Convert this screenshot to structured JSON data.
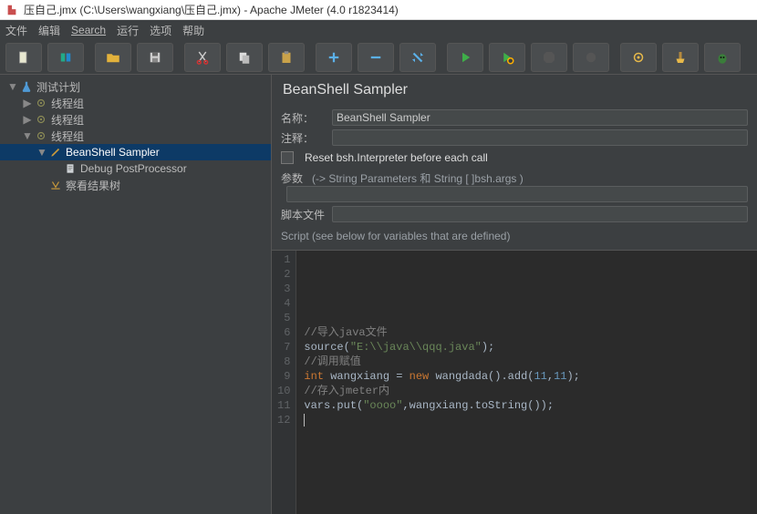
{
  "window": {
    "title": "压自己.jmx (C:\\Users\\wangxiang\\压自己.jmx) - Apache JMeter (4.0 r1823414)"
  },
  "menus": {
    "file": "文件",
    "edit": "编辑",
    "search": "Search",
    "run": "运行",
    "options": "选项",
    "help": "帮助"
  },
  "toolbar_icons": [
    "new-file-icon",
    "templates-icon",
    "open-icon",
    "save-icon",
    "cut-icon",
    "copy-icon",
    "paste-icon",
    "expand-icon",
    "collapse-icon",
    "toggle-icon",
    "start-icon",
    "start-no-timers-icon",
    "stop-icon",
    "shutdown-icon",
    "gear-icon",
    "broom-icon",
    "function-icon"
  ],
  "tree": [
    {
      "indent": 8,
      "toggle": "▼",
      "icon": "flask",
      "label": "测试计划",
      "selected": false,
      "name": "tree-testplan"
    },
    {
      "indent": 24,
      "toggle": "▶",
      "icon": "thread",
      "label": "线程组",
      "selected": false,
      "name": "tree-threadgroup-1"
    },
    {
      "indent": 24,
      "toggle": "▶",
      "icon": "thread",
      "label": "线程组",
      "selected": false,
      "name": "tree-threadgroup-2"
    },
    {
      "indent": 24,
      "toggle": "▼",
      "icon": "thread",
      "label": "线程组",
      "selected": false,
      "name": "tree-threadgroup-3"
    },
    {
      "indent": 40,
      "toggle": "▼",
      "icon": "pen",
      "label": "BeanShell Sampler",
      "selected": true,
      "name": "tree-beanshell-sampler"
    },
    {
      "indent": 56,
      "toggle": "",
      "icon": "doc",
      "label": "Debug PostProcessor",
      "selected": false,
      "name": "tree-debug-postprocessor"
    },
    {
      "indent": 40,
      "toggle": "",
      "icon": "eye",
      "label": "察看结果树",
      "selected": false,
      "name": "tree-view-results"
    }
  ],
  "panel": {
    "title": "BeanShell Sampler",
    "name_label": "名称：",
    "name_value": "BeanShell Sampler",
    "comment_label": "注释：",
    "comment_value": "",
    "reset_label": "Reset bsh.Interpreter before each call",
    "params_label": "参数",
    "params_hint": "(-> String Parameters 和 String [ ]bsh.args )",
    "params_value": "",
    "scriptfile_label": "脚本文件",
    "scriptfile_value": "",
    "script_header": "Script (see below for variables that are defined)"
  },
  "code": {
    "line_count": 12,
    "lines": [
      {
        "n": 1,
        "segments": []
      },
      {
        "n": 2,
        "segments": []
      },
      {
        "n": 3,
        "segments": []
      },
      {
        "n": 4,
        "segments": []
      },
      {
        "n": 5,
        "segments": []
      },
      {
        "n": 6,
        "segments": [
          {
            "c": "c-comment",
            "t": "//导入java文件"
          }
        ]
      },
      {
        "n": 7,
        "segments": [
          {
            "c": "c-plain",
            "t": "source("
          },
          {
            "c": "c-string",
            "t": "\"E:\\\\java\\\\qqq.java\""
          },
          {
            "c": "c-plain",
            "t": ");"
          }
        ]
      },
      {
        "n": 8,
        "segments": [
          {
            "c": "c-comment",
            "t": "//调用赋值"
          }
        ]
      },
      {
        "n": 9,
        "segments": [
          {
            "c": "c-keyword",
            "t": "int"
          },
          {
            "c": "c-plain",
            "t": " wangxiang = "
          },
          {
            "c": "c-keyword",
            "t": "new"
          },
          {
            "c": "c-plain",
            "t": " wangdada().add("
          },
          {
            "c": "c-number",
            "t": "11"
          },
          {
            "c": "c-plain",
            "t": ","
          },
          {
            "c": "c-number",
            "t": "11"
          },
          {
            "c": "c-plain",
            "t": ");"
          }
        ]
      },
      {
        "n": 10,
        "segments": [
          {
            "c": "c-comment",
            "t": "//存入jmeter内"
          }
        ]
      },
      {
        "n": 11,
        "segments": [
          {
            "c": "c-plain",
            "t": "vars.put("
          },
          {
            "c": "c-string",
            "t": "\"oooo\""
          },
          {
            "c": "c-plain",
            "t": ",wangxiang.toString());"
          }
        ]
      },
      {
        "n": 12,
        "segments": []
      }
    ]
  }
}
